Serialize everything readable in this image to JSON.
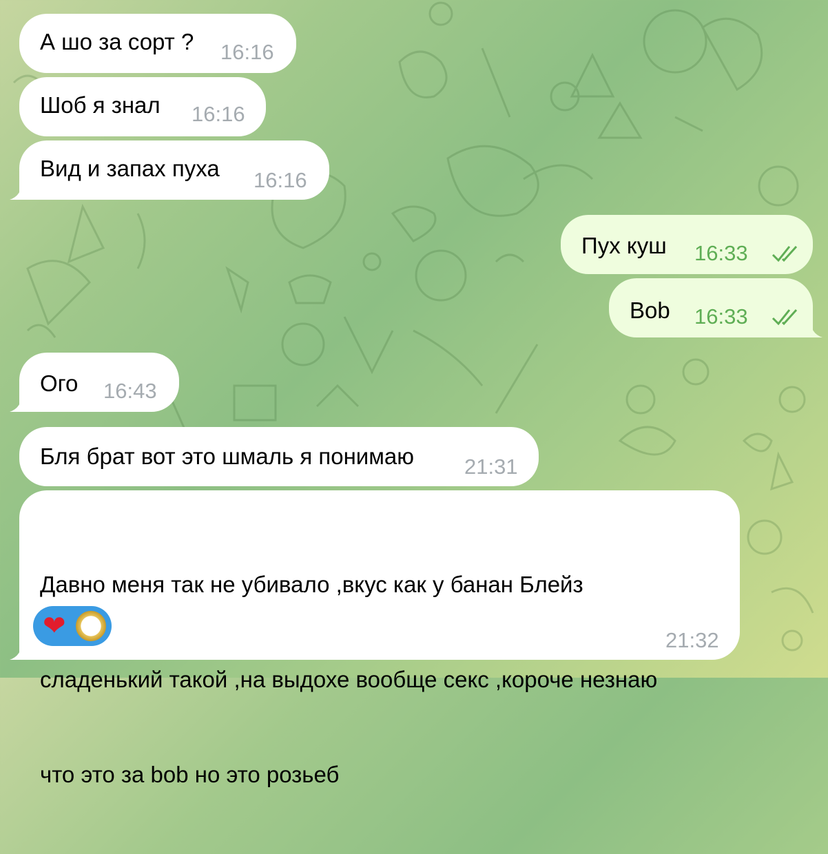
{
  "chat": {
    "messages": [
      {
        "direction": "incoming",
        "text": "А шо за сорт ?",
        "time": "16:16"
      },
      {
        "direction": "incoming",
        "text": "Шоб я знал",
        "time": "16:16"
      },
      {
        "direction": "incoming",
        "text": "Вид и запах пуха",
        "time": "16:16"
      },
      {
        "direction": "outgoing",
        "text": "Пух куш",
        "time": "16:33",
        "status": "read"
      },
      {
        "direction": "outgoing",
        "text": "Bob",
        "time": "16:33",
        "status": "read"
      },
      {
        "direction": "incoming",
        "text": "Ого",
        "time": "16:43"
      },
      {
        "direction": "incoming",
        "text": "Бля брат вот это шмаль я понимаю",
        "time": "21:31"
      },
      {
        "direction": "incoming",
        "text_lines": [
          "Давно меня так не убивало ,вкус как у банан Блейз",
          "сладенький такой ,на выдохе вообще секс ,короче незнаю",
          "что это за bob но это розьеб"
        ],
        "time": "21:32",
        "reactions": [
          {
            "emoji": "❤",
            "icon": "heart-icon"
          },
          {
            "icon": "reactor-avatar"
          }
        ]
      }
    ]
  },
  "colors": {
    "incoming_bubble": "#ffffff",
    "outgoing_bubble": "#effdde",
    "incoming_time": "#a5abb0",
    "outgoing_time": "#5fae55",
    "reaction_pill": "#3a9be3",
    "heart": "#e21c2c"
  }
}
